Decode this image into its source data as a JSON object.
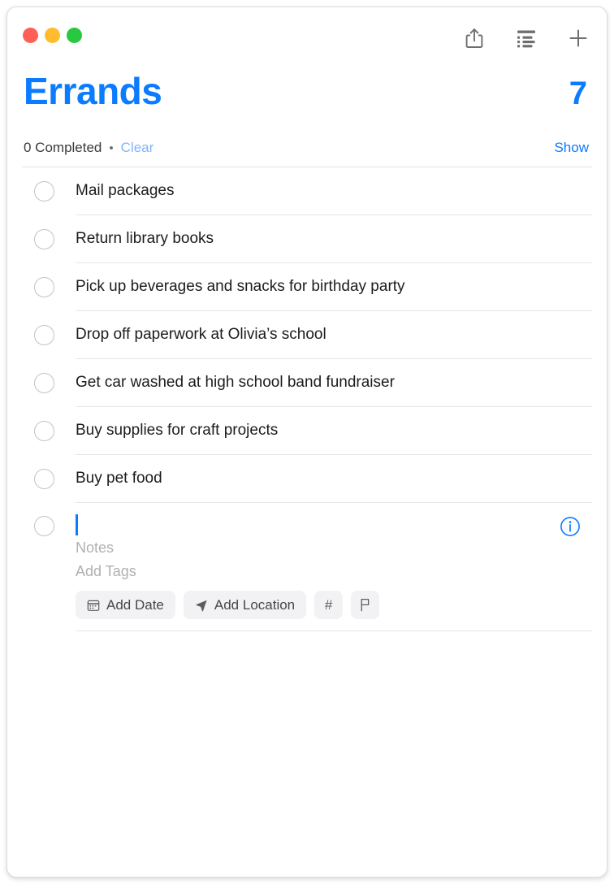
{
  "window": {
    "traffic_lights": [
      {
        "name": "close",
        "color": "#ff5f57"
      },
      {
        "name": "minimize",
        "color": "#febc2e"
      },
      {
        "name": "maximize",
        "color": "#28c840"
      }
    ]
  },
  "toolbar": {
    "share_icon": "share-icon",
    "list_view_icon": "list-view-icon",
    "add_icon": "plus-icon"
  },
  "header": {
    "title": "Errands",
    "count": "7",
    "completed_label": "0 Completed",
    "separator_dot": "•",
    "clear_label": "Clear",
    "show_label": "Show",
    "accent_color": "#0b7bff",
    "clear_color": "#7eb4fd"
  },
  "tasks": [
    {
      "title": "Mail packages",
      "completed": false
    },
    {
      "title": "Return library books",
      "completed": false
    },
    {
      "title": "Pick up beverages and snacks for birthday party",
      "completed": false
    },
    {
      "title": "Drop off paperwork at Olivia’s school",
      "completed": false
    },
    {
      "title": "Get car washed at high school band fundraiser",
      "completed": false
    },
    {
      "title": "Buy supplies for craft projects",
      "completed": false
    },
    {
      "title": "Buy pet food",
      "completed": false
    }
  ],
  "new_item": {
    "title_value": "",
    "notes_placeholder": "Notes",
    "tags_placeholder": "Add Tags",
    "caret_color": "#0b7bff",
    "chips": [
      {
        "label": "Add Date",
        "icon": "calendar-icon"
      },
      {
        "label": "Add Location",
        "icon": "location-arrow-icon"
      },
      {
        "label": "#",
        "icon": "hashtag-icon"
      },
      {
        "label": "",
        "icon": "flag-icon"
      }
    ],
    "info_icon": "info-circle-icon"
  }
}
